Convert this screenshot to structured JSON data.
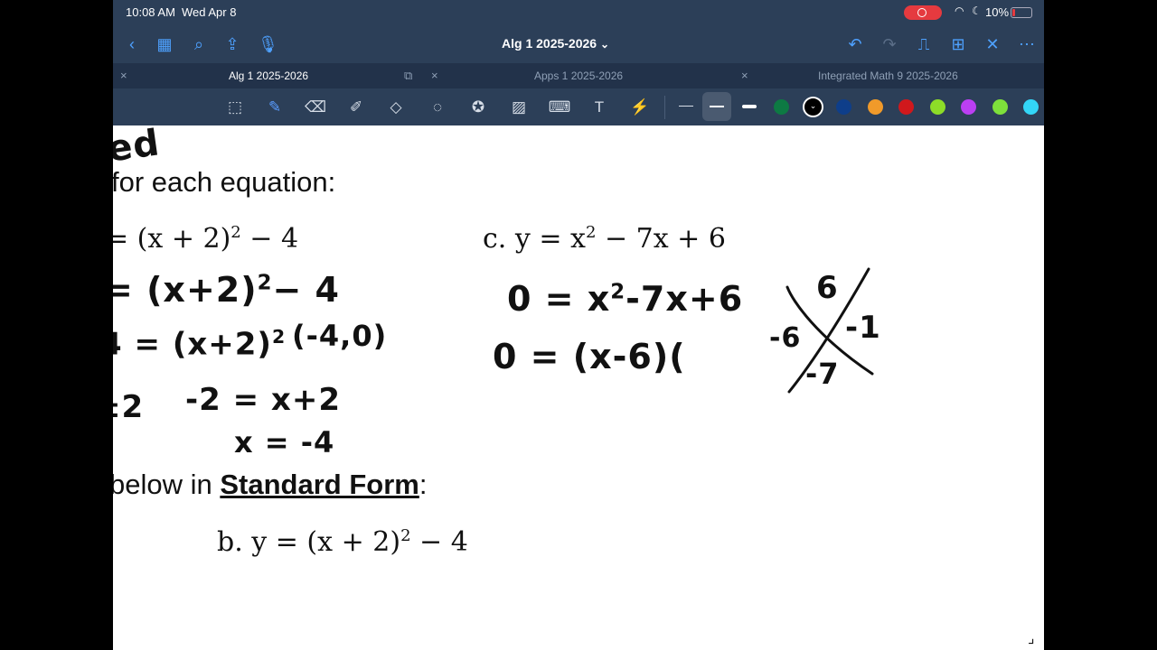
{
  "status_bar": {
    "time": "10:08 AM",
    "date": "Wed Apr 8",
    "battery": "10%"
  },
  "nav": {
    "title": "Alg 1 2025-2026",
    "title_chevron": "⌄"
  },
  "tabs": [
    {
      "label": "Alg 1 2025-2026",
      "active": true
    },
    {
      "label": "Apps 1 2025-2026",
      "active": false
    },
    {
      "label": "Integrated Math 9 2025-2026",
      "active": false
    }
  ],
  "toolbar": {
    "tools": [
      "image-lasso-icon",
      "pen-icon",
      "eraser-icon",
      "highlighter-icon",
      "shapes-icon",
      "lasso-icon",
      "sticker-icon",
      "image-icon",
      "keyboard-icon",
      "text-box-icon",
      "laser-pointer-icon"
    ],
    "colors": [
      "#0d7a43",
      "#000000",
      "#0e3e8a",
      "#f09a2a",
      "#d0181c",
      "#8ddc28",
      "#bb3ff2",
      "#7ee03b",
      "#33d6f7"
    ]
  },
  "document": {
    "title_fragment": "ed",
    "instruction1": "for each equation:",
    "eq_a": "= (x + 2)",
    "eq_a_exp": "2",
    "eq_a_rest": " − 4",
    "eq_c": "c.  y = x",
    "eq_c_exp": "2",
    "eq_c_rest": " − 7x + 6",
    "instruction2_pre": " below in ",
    "instruction2_bold": "Standard Form",
    "instruction2_post": ":",
    "eq_b": "b.  y = (x + 2)",
    "eq_b_exp": "2",
    "eq_b_rest": " − 4",
    "handwriting": {
      "l1": "= (x+2)",
      "l1_exp": "2",
      "l1_rest": "− 4",
      "l2": "4 = (x+2)",
      "l2_exp": "2",
      "l2_point": "(-4,0)",
      "l3a": "±2",
      "l3b": "-2 = x+2",
      "l4": "x = -4",
      "c1": "0 = x",
      "c1_exp": "2",
      "c1_rest": "-7x+6",
      "c2": "0 = (x-6)(",
      "x_top": "6",
      "x_left": "-6",
      "x_right": "-1",
      "x_bottom": "-7"
    }
  }
}
